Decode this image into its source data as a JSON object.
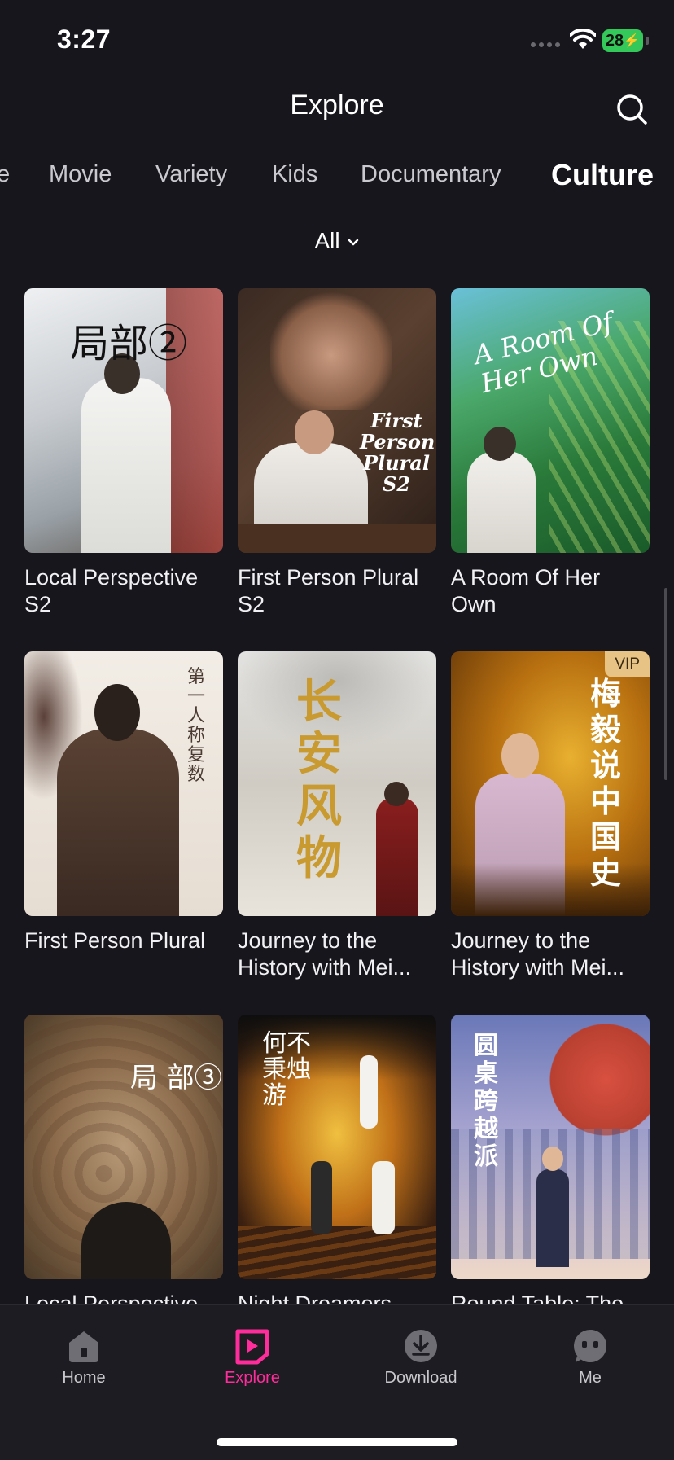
{
  "status": {
    "time": "3:27",
    "battery": "28"
  },
  "header": {
    "title": "Explore"
  },
  "tabs": [
    {
      "label": "e"
    },
    {
      "label": "Movie"
    },
    {
      "label": "Variety"
    },
    {
      "label": "Kids"
    },
    {
      "label": "Documentary"
    },
    {
      "label": "Culture"
    }
  ],
  "filter": {
    "label": "All"
  },
  "cards": [
    {
      "title": "Local Perspective S2",
      "poster_text": "局部②"
    },
    {
      "title": "First Person Plural S2",
      "poster_text": "First Person Plural S2"
    },
    {
      "title": "A Room Of Her Own",
      "poster_text": "A Room Of Her Own"
    },
    {
      "title": "First Person Plural",
      "poster_text": "第一人称复数"
    },
    {
      "title": "Journey to the History with Mei...",
      "poster_text": "长安风物"
    },
    {
      "title": "Journey to the History with Mei...",
      "poster_text": "梅毅说中国史",
      "badge": "VIP"
    },
    {
      "title": "Local Perspective",
      "poster_text": "局 部③"
    },
    {
      "title": "Night Dreamers",
      "poster_text": "何不秉烛游"
    },
    {
      "title": "Round Table: The",
      "poster_text": "圆桌跨越派"
    }
  ],
  "nav": [
    {
      "label": "Home",
      "icon": "home-icon"
    },
    {
      "label": "Explore",
      "icon": "explore-icon"
    },
    {
      "label": "Download",
      "icon": "download-icon"
    },
    {
      "label": "Me",
      "icon": "me-icon"
    }
  ],
  "colors": {
    "background": "#16161c",
    "accent": "#ff2d9b",
    "vip": "#e7c486",
    "battery": "#34c759"
  }
}
